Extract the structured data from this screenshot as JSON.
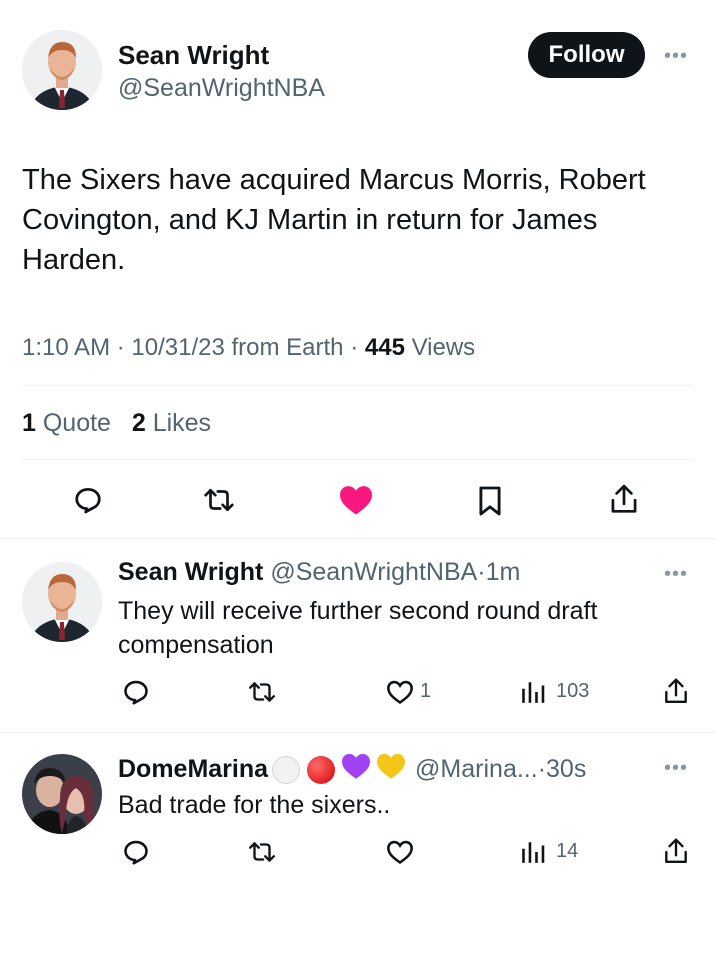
{
  "main_tweet": {
    "author_name": "Sean Wright",
    "author_handle": "@SeanWrightNBA",
    "follow_label": "Follow",
    "text": "The Sixers have acquired Marcus Morris, Robert Covington, and KJ Martin in return for James Harden.",
    "time": "1:10 AM",
    "date": "10/31/23",
    "source": "from Earth",
    "views_count": "445",
    "views_label": "Views",
    "quotes_count": "1",
    "quotes_label": "Quote",
    "likes_count": "2",
    "likes_label": "Likes",
    "liked": true,
    "like_color": "#f91880"
  },
  "replies": [
    {
      "author_name": "Sean Wright",
      "author_handle": "@SeanWrightNBA",
      "time": "1m",
      "text_line1": "They will receive further second round draft",
      "text_line2": "compensation",
      "likes": "1",
      "views": "103"
    },
    {
      "author_name": "DomeMarina",
      "emojis": [
        "white-circle",
        "red-circle",
        "purple-heart",
        "yellow-heart"
      ],
      "author_handle": "@Marina...",
      "time": "30s",
      "text_line1": "Bad trade for the sixers..",
      "likes": "",
      "views": "14"
    }
  ],
  "separator": "·"
}
